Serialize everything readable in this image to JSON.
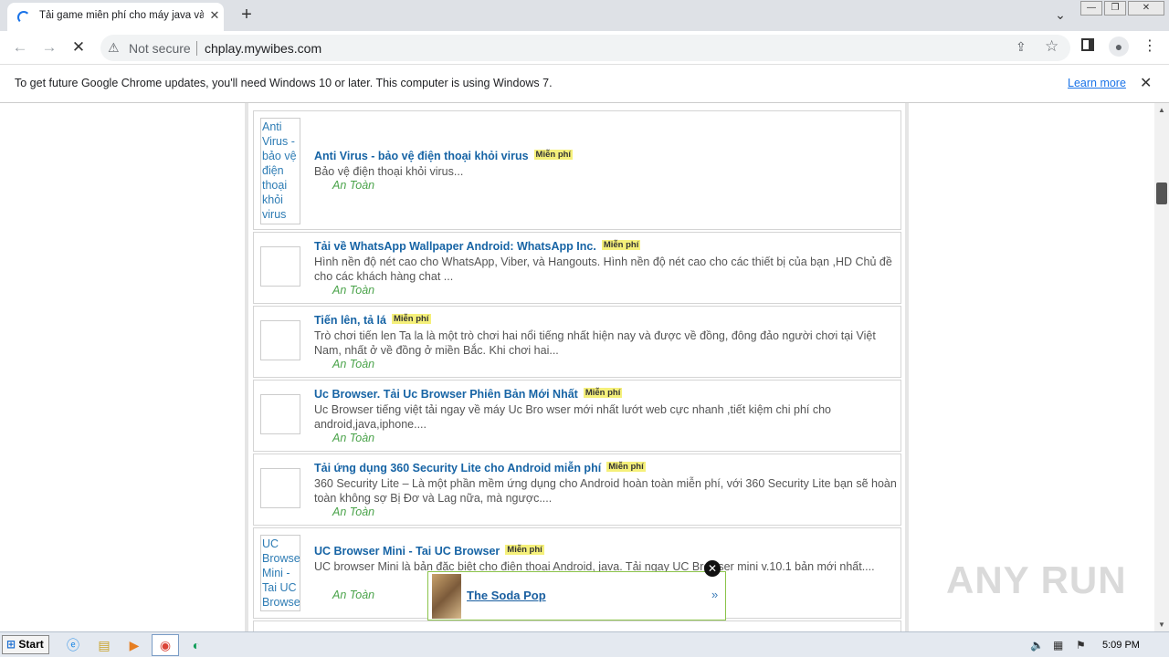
{
  "browser": {
    "tab_title": "Tải game miễn phí cho máy java và a",
    "new_tab": "+",
    "tab_close": "✕",
    "not_secure": "Not secure",
    "url": "chplay.mywibes.com"
  },
  "infobar": {
    "message": "To get future Google Chrome updates, you'll need Windows 10 or later. This computer is using Windows 7.",
    "learn_more": "Learn more",
    "close": "✕"
  },
  "list": {
    "free_label": "Miễn phí",
    "safe_label": "An Toàn",
    "items": [
      {
        "title": "Anti Virus - bảo vệ điện thoại khỏi virus",
        "desc": "Bảo vệ điện thoại khỏi virus...",
        "thumb_alt": "Anti Virus - bảo vệ điện thoại khỏi virus"
      },
      {
        "title": "Tải về WhatsApp Wallpaper Android: WhatsApp Inc.",
        "desc": "Hình nền độ nét cao cho WhatsApp, Viber, và Hangouts. Hình nền độ nét cao cho các thiết bị của bạn ,HD Chủ đề cho các khách hàng chat ...",
        "thumb_alt": ""
      },
      {
        "title": "Tiến lên, tả lá",
        "desc": "Trò chơi tiến len Ta la là một trò chơi hai nổi tiếng nhất hiện nay và được về đồng, đông đảo người chơi tại Việt Nam, nhất ở về đồng ở miền Bắc. Khi chơi hai...",
        "thumb_alt": ""
      },
      {
        "title": "Uc Browser. Tải Uc Browser Phiên Bản Mới Nhất",
        "desc": "Uc Browser tiếng việt tải ngay về máy Uc Bro wser mới nhất lướt web cực nhanh ,tiết kiệm chi phí cho android,java,iphone....",
        "thumb_alt": ""
      },
      {
        "title": "Tải ứng dụng 360 Security Lite cho Android miễn phí",
        "desc": "360 Security Lite – Là một phần mềm ứng dụng cho Android hoàn toàn miễn phí, với 360 Security Lite bạn sẽ hoàn toàn không sợ Bị Đơ và Lag nữa, mà ngược....",
        "thumb_alt": ""
      },
      {
        "title": "UC Browser Mini - Tai UC Browser",
        "desc": "UC browser Mini là bản đặc biệt cho điện thoại Android, java. Tải ngay UC Browser mini v.10.1 bản mới nhất....",
        "thumb_alt": "UC Browser Mini - Tai UC Browser"
      }
    ]
  },
  "ad": {
    "title": "The Soda Pop",
    "arrow": "»",
    "close": "✕"
  },
  "watermark": "ANY RUN",
  "taskbar": {
    "start": "Start",
    "time": "5:09 PM"
  },
  "colors": {
    "link": "#1764a5",
    "safe": "#4aa34a",
    "badge": "#f5f07a"
  }
}
